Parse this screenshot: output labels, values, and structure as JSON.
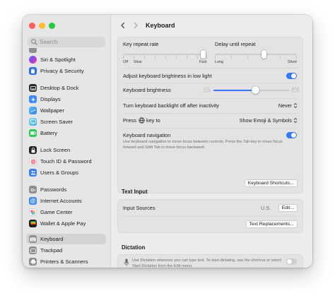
{
  "window": {
    "title": "Keyboard",
    "traffic_lights": {
      "close": "#ff5f57",
      "minimize": "#febc2e",
      "zoom": "#28c840"
    }
  },
  "sidebar": {
    "search_placeholder": "Search",
    "items": [
      {
        "label": "Siri & Spotlight",
        "icon": "siri-icon",
        "color": "#7a3cf0"
      },
      {
        "label": "Privacy & Security",
        "icon": "hand-icon",
        "color": "#2f6fe4"
      },
      {
        "label": "Desktop & Dock",
        "icon": "dock-icon",
        "color": "#1f1f1f"
      },
      {
        "label": "Displays",
        "icon": "display-icon",
        "color": "#3a8af5"
      },
      {
        "label": "Wallpaper",
        "icon": "wallpaper-icon",
        "color": "#39a7f0"
      },
      {
        "label": "Screen Saver",
        "icon": "screensaver-icon",
        "color": "#43b9e6"
      },
      {
        "label": "Battery",
        "icon": "battery-icon",
        "color": "#34c759"
      },
      {
        "label": "Lock Screen",
        "icon": "lock-screen-icon",
        "color": "#1f1f1f"
      },
      {
        "label": "Touch ID & Password",
        "icon": "fingerprint-icon",
        "color": "#f2f2f2"
      },
      {
        "label": "Users & Groups",
        "icon": "users-icon",
        "color": "#3a7ef0"
      },
      {
        "label": "Passwords",
        "icon": "key-icon",
        "color": "#8e8e93"
      },
      {
        "label": "Internet Accounts",
        "icon": "at-icon",
        "color": "#3a8af5"
      },
      {
        "label": "Game Center",
        "icon": "game-center-icon",
        "color": "#ffffff"
      },
      {
        "label": "Wallet & Apple Pay",
        "icon": "wallet-icon",
        "color": "#1f1f1f"
      },
      {
        "label": "Keyboard",
        "icon": "keyboard-icon",
        "color": "#8e8e93",
        "selected": true
      },
      {
        "label": "Trackpad",
        "icon": "trackpad-icon",
        "color": "#8e8e93"
      },
      {
        "label": "Printers & Scanners",
        "icon": "printer-icon",
        "color": "#8e8e93"
      }
    ]
  },
  "keyboard": {
    "key_repeat": {
      "label": "Key repeat rate",
      "min_label": "Off",
      "low_label": "Slow",
      "max_label": "Fast",
      "level": 0.95
    },
    "delay_repeat": {
      "label": "Delay until repeat",
      "min_label": "Long",
      "max_label": "Short",
      "level": 0.6
    },
    "adjust_brightness": {
      "label": "Adjust keyboard brightness in low light",
      "on": true
    },
    "brightness": {
      "label": "Keyboard brightness",
      "level": 0.55
    },
    "backlight_off": {
      "label": "Turn keyboard backlight off after inactivity",
      "value": "Never"
    },
    "press_key": {
      "label_before": "Press",
      "label_after": "key to",
      "value": "Show Emoji & Symbols"
    },
    "keyboard_navigation": {
      "label": "Keyboard navigation",
      "description": "Use keyboard navigation to move focus between controls. Press the Tab key to move focus forward and Shift Tab to move focus backward.",
      "on": true
    },
    "shortcuts_button": "Keyboard Shortcuts..."
  },
  "text_input": {
    "section_title": "Text Input",
    "input_sources_label": "Input Sources",
    "input_sources_value": "U.S.",
    "edit_button": "Edit...",
    "replacements_button": "Text Replacements..."
  },
  "dictation": {
    "section_title": "Dictation",
    "description": "Use Dictation wherever you can type text. To start dictating, use the shortcut or select Start Dictation from the Edit menu.",
    "on": false
  },
  "accent_color": "#3478f6"
}
